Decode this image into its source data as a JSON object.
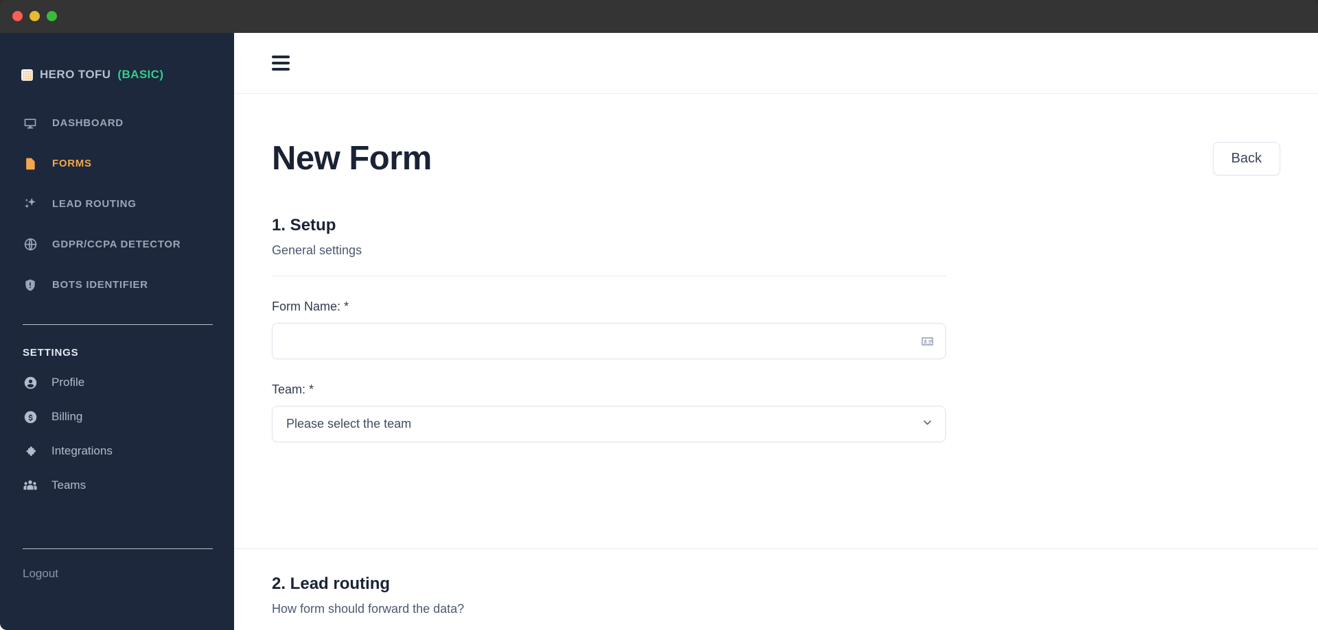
{
  "window": {
    "traffic_lights": [
      "close",
      "minimize",
      "zoom"
    ],
    "colors": {
      "close": "#fc5d55",
      "minimize": "#e6bb2e",
      "zoom": "#3bb93a"
    }
  },
  "sidebar": {
    "brand": {
      "name": "HERO TOFU",
      "plan": "(BASIC)",
      "logo_icon": "tofu-block-icon"
    },
    "primary_nav": [
      {
        "label": "DASHBOARD",
        "icon": "monitor-icon",
        "active": false
      },
      {
        "label": "FORMS",
        "icon": "document-icon",
        "active": true
      },
      {
        "label": "LEAD ROUTING",
        "icon": "sparkles-icon",
        "active": false
      },
      {
        "label": "GDPR/CCPA DETECTOR",
        "icon": "globe-icon",
        "active": false
      },
      {
        "label": "BOTS IDENTIFIER",
        "icon": "shield-alert-icon",
        "active": false
      }
    ],
    "settings_label": "SETTINGS",
    "settings_nav": [
      {
        "label": "Profile",
        "icon": "user-circle-icon"
      },
      {
        "label": "Billing",
        "icon": "dollar-circle-icon"
      },
      {
        "label": "Integrations",
        "icon": "puzzle-piece-icon"
      },
      {
        "label": "Teams",
        "icon": "people-group-icon"
      }
    ],
    "logout_label": "Logout",
    "accent_active": "#f2a74d",
    "plan_color": "#2fd08a",
    "background": "#1d283c"
  },
  "topbar": {
    "menu_icon": "hamburger-icon"
  },
  "page": {
    "title": "New Form",
    "back_label": "Back"
  },
  "sections": [
    {
      "title": "1. Setup",
      "subtitle": "General settings",
      "fields": {
        "form_name": {
          "label": "Form Name: *",
          "value": "",
          "placeholder": "",
          "trailing_icon": "id-card-icon"
        },
        "team": {
          "label": "Team: *",
          "selected": "Please select the team",
          "chevron_icon": "chevron-down-icon"
        }
      }
    },
    {
      "title": "2. Lead routing",
      "subtitle": "How form should forward the data?"
    }
  ]
}
